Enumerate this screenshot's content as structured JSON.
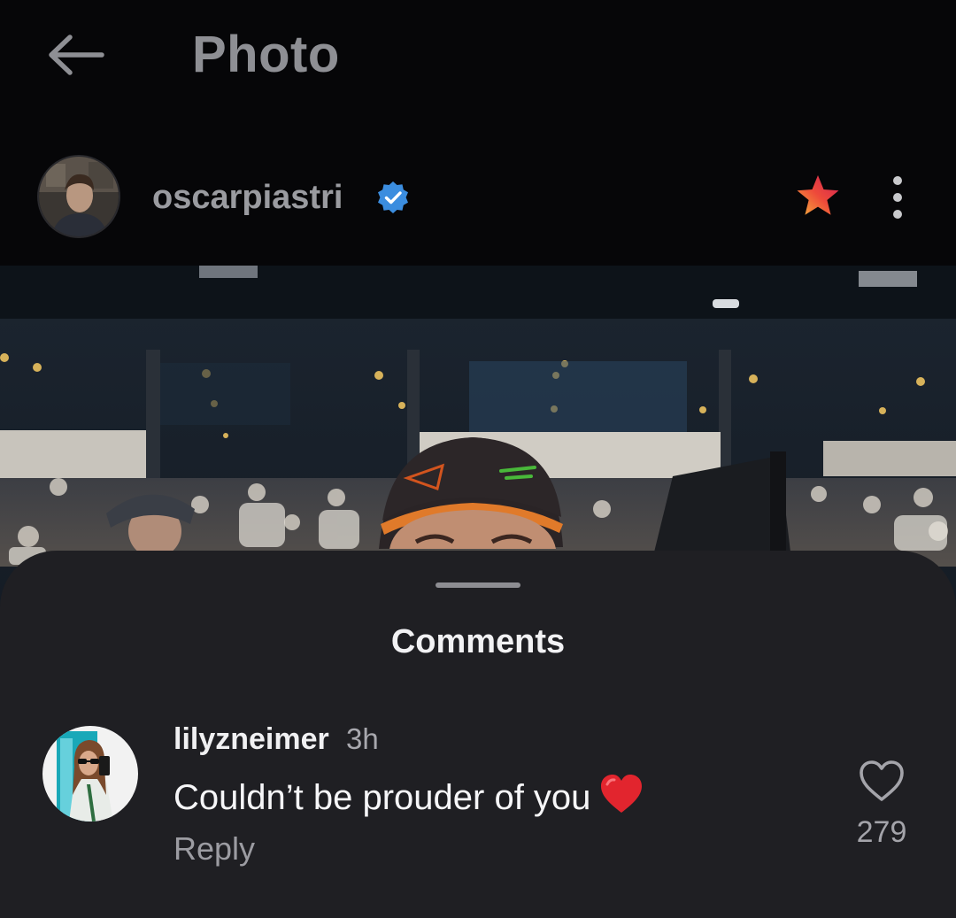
{
  "header": {
    "title": "Photo",
    "back_icon": "arrow-left-icon"
  },
  "post": {
    "username": "oscarpiastri",
    "verified": true,
    "badge_icon": "verified-badge-icon",
    "favorite_icon": "star-icon",
    "more_icon": "more-vertical-icon"
  },
  "comments_sheet": {
    "title": "Comments",
    "comments": [
      {
        "username": "lilyzneimer",
        "time": "3h",
        "text": "Couldn’t be prouder of you",
        "emoji": "red-heart",
        "reply_label": "Reply",
        "like_count": "279",
        "like_icon": "heart-outline-icon"
      }
    ]
  },
  "colors": {
    "background": "#060608",
    "sheet": "#1f1f23",
    "verified_blue": "#3b8ddf",
    "star_gradient_start": "#f4b23c",
    "star_gradient_end": "#d11f56",
    "heart_red": "#e2252e"
  }
}
